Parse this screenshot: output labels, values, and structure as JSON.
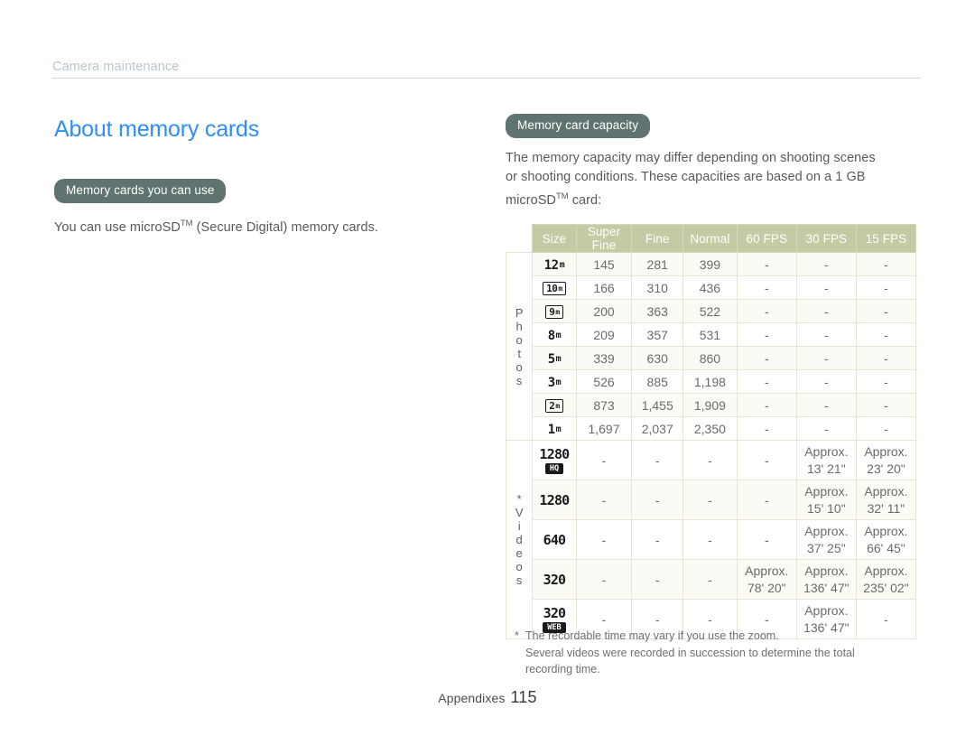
{
  "header": {
    "breadcrumb": "Camera maintenance"
  },
  "left": {
    "title": "About memory cards",
    "section_badge": "Memory cards you can use",
    "paragraph_pre": "You can use microSD",
    "paragraph_sup": "TM",
    "paragraph_post": " (Secure Digital) memory cards."
  },
  "right": {
    "section_badge": "Memory card capacity",
    "intro_line1": "The memory capacity may differ depending on shooting scenes",
    "intro_line2": "or shooting conditions. These capacities are based on a 1 GB",
    "intro_line3_pre": "microSD",
    "intro_line3_sup": "TM",
    "intro_line3_post": " card:"
  },
  "table": {
    "headers": [
      "Size",
      "Super Fine",
      "Fine",
      "Normal",
      "60 FPS",
      "30 FPS",
      "15 FPS"
    ],
    "groups": {
      "photos": "Photos",
      "videos": "*Videos"
    },
    "photo_rows": [
      {
        "size_num": "12",
        "size_unit": "m",
        "framed": false,
        "cells": [
          "145",
          "281",
          "399",
          "-",
          "-",
          "-"
        ]
      },
      {
        "size_num": "10",
        "size_unit": "m",
        "framed": true,
        "cells": [
          "166",
          "310",
          "436",
          "-",
          "-",
          "-"
        ]
      },
      {
        "size_num": "9",
        "size_unit": "m",
        "framed": true,
        "cells": [
          "200",
          "363",
          "522",
          "-",
          "-",
          "-"
        ]
      },
      {
        "size_num": "8",
        "size_unit": "m",
        "framed": false,
        "cells": [
          "209",
          "357",
          "531",
          "-",
          "-",
          "-"
        ]
      },
      {
        "size_num": "5",
        "size_unit": "m",
        "framed": false,
        "cells": [
          "339",
          "630",
          "860",
          "-",
          "-",
          "-"
        ]
      },
      {
        "size_num": "3",
        "size_unit": "m",
        "framed": false,
        "cells": [
          "526",
          "885",
          "1,198",
          "-",
          "-",
          "-"
        ]
      },
      {
        "size_num": "2",
        "size_unit": "m",
        "framed": true,
        "cells": [
          "873",
          "1,455",
          "1,909",
          "-",
          "-",
          "-"
        ]
      },
      {
        "size_num": "1",
        "size_unit": "m",
        "framed": false,
        "cells": [
          "1,697",
          "2,037",
          "2,350",
          "-",
          "-",
          "-"
        ]
      }
    ],
    "video_rows": [
      {
        "size_num": "1280",
        "tag": "HQ",
        "cells": [
          "-",
          "-",
          "-",
          "-",
          "Approx.|13' 21\"",
          "Approx.|23' 20\""
        ]
      },
      {
        "size_num": "1280",
        "tag": "",
        "cells": [
          "-",
          "-",
          "-",
          "-",
          "Approx.|15' 10\"",
          "Approx.|32' 11\""
        ]
      },
      {
        "size_num": "640",
        "tag": "",
        "cells": [
          "-",
          "-",
          "-",
          "-",
          "Approx.|37' 25\"",
          "Approx.|66' 45\""
        ]
      },
      {
        "size_num": "320",
        "tag": "",
        "cells": [
          "-",
          "-",
          "-",
          "Approx.|78' 20\"",
          "Approx.|136' 47\"",
          "Approx.|235' 02\""
        ]
      },
      {
        "size_num": "320",
        "tag": "WEB",
        "cells": [
          "-",
          "-",
          "-",
          "-",
          "Approx.|136' 47\"",
          "-"
        ]
      }
    ]
  },
  "footnote": {
    "star": "*",
    "line1": "The recordable time may vary if you use the zoom.",
    "line2": "Several videos were recorded in succession to determine the total",
    "line3": "recording time."
  },
  "footer": {
    "section": "Appendixes",
    "page_number": "115"
  },
  "colors": {
    "title_blue": "#2e8ef7",
    "badge_bg": "#5f7470",
    "table_header_bg": "#c5c9a4",
    "table_border": "#e8e5d7",
    "crumb": "#b9c7cc"
  }
}
